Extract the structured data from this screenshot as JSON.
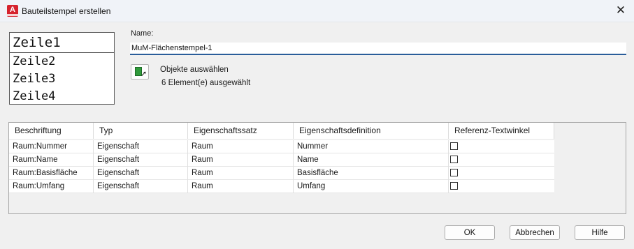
{
  "window": {
    "title": "Bauteilstempel erstellen",
    "app_icon": "A"
  },
  "preview": {
    "lines": [
      "Zeile1",
      "Zeile2",
      "Zeile3",
      "Zeile4"
    ]
  },
  "name": {
    "label": "Name:",
    "value": "MuM-Flächenstempel-1"
  },
  "selection": {
    "button_label": "Objekte auswählen",
    "count_text": "6 Element(e) ausgewählt"
  },
  "table": {
    "headers": [
      "Beschriftung",
      "Typ",
      "Eigenschaftssatz",
      "Eigenschaftsdefinition",
      "Referenz-Textwinkel"
    ],
    "rows": [
      {
        "beschriftung": "Raum:Nummer",
        "typ": "Eigenschaft",
        "satz": "Raum",
        "definition": "Nummer",
        "textwinkel": false
      },
      {
        "beschriftung": "Raum:Name",
        "typ": "Eigenschaft",
        "satz": "Raum",
        "definition": "Name",
        "textwinkel": false
      },
      {
        "beschriftung": "Raum:Basisfläche",
        "typ": "Eigenschaft",
        "satz": "Raum",
        "definition": "Basisfläche",
        "textwinkel": false
      },
      {
        "beschriftung": "Raum:Umfang",
        "typ": "Eigenschaft",
        "satz": "Raum",
        "definition": "Umfang",
        "textwinkel": false
      }
    ]
  },
  "buttons": {
    "ok": "OK",
    "cancel": "Abbrechen",
    "help": "Hilfe"
  },
  "colors": {
    "app_red": "#d6232e",
    "focus_blue": "#2a5d9a",
    "select_green": "#2f9a3b"
  }
}
